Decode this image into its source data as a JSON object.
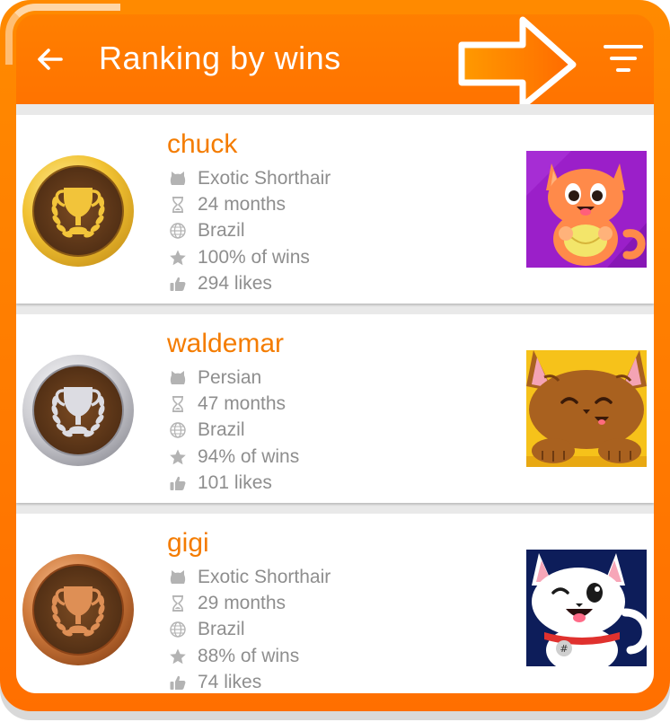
{
  "header": {
    "title": "Ranking by wins",
    "back_icon": "arrow-left-icon",
    "filter_icon": "filter-icon",
    "hint_icon": "pointing-arrow-icon"
  },
  "colors": {
    "accent": "#FF7A00",
    "name": "#F47C00",
    "text_muted": "#8E8E8E",
    "gold": "#E9B62A",
    "silver": "#C9C9CE",
    "bronze": "#C8743C"
  },
  "cats": [
    {
      "rank_medal": "gold-trophy-icon",
      "name": "chuck",
      "breed": "Exotic Shorthair",
      "age": "24 months",
      "country": "Brazil",
      "wins": "100% of wins",
      "likes": "294 likes"
    },
    {
      "rank_medal": "silver-trophy-icon",
      "name": "waldemar",
      "breed": "Persian",
      "age": "47 months",
      "country": "Brazil",
      "wins": "94% of wins",
      "likes": "101 likes"
    },
    {
      "rank_medal": "bronze-trophy-icon",
      "name": "gigi",
      "breed": "Exotic Shorthair",
      "age": "29 months",
      "country": "Brazil",
      "wins": "88% of wins",
      "likes": "74 likes"
    }
  ]
}
